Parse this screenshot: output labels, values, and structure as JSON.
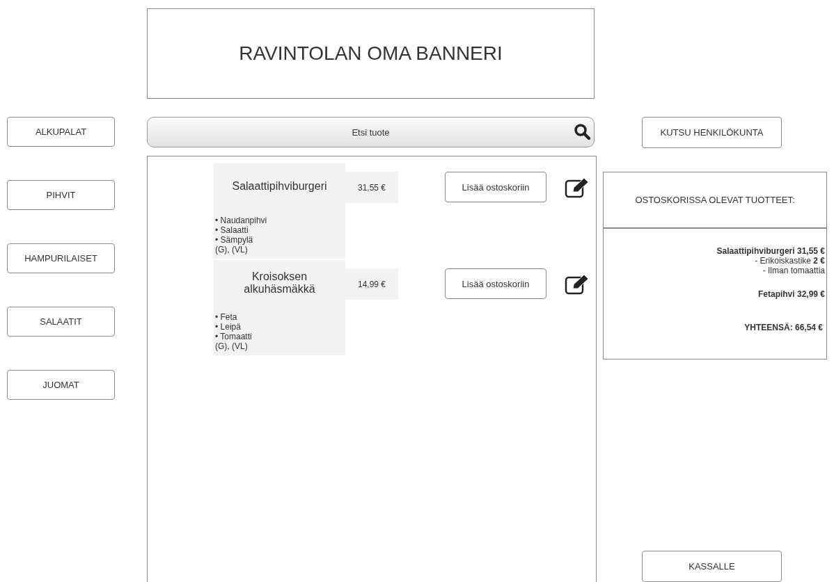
{
  "banner": {
    "text": "RAVINTOLAN OMA BANNERI"
  },
  "categories": [
    {
      "label": "ALKUPALAT"
    },
    {
      "label": "PIHVIT"
    },
    {
      "label": "HAMPURILAISET"
    },
    {
      "label": "SALAATIT"
    },
    {
      "label": "JUOMAT"
    }
  ],
  "search": {
    "placeholder": "Etsi tuote"
  },
  "products": [
    {
      "name": "Salaattipihviburgeri",
      "price": "31,55 €",
      "ingredients": [
        "• Naudanpihvi",
        "• Salaatti",
        "• Sämpylä"
      ],
      "diet": "(G), (VL)",
      "button": "Lisää ostoskoriin"
    },
    {
      "name": "Kroisoksen alkuhäsmäkkä",
      "price": "14,99 €",
      "ingredients": [
        "• Feta",
        "• Leipä",
        "• Tomaatti"
      ],
      "diet": "(G), (VL)",
      "button": "Lisää ostoskoriin"
    }
  ],
  "staff_button": "KUTSU HENKILÖKUNTA",
  "cart": {
    "title": "OSTOSKORISSA OLEVAT TUOTTEET:",
    "lines": [
      {
        "kind": "item",
        "text": "Salaattipihviburgeri 31,55 €"
      },
      {
        "kind": "option",
        "text": "- Erikoiskastike **2 €**"
      },
      {
        "kind": "option",
        "text": "- Ilman tomaattia"
      },
      {
        "kind": "item",
        "text": "Fetapihvi 32,99 €"
      },
      {
        "kind": "total",
        "text": "YHTEENSÄ: 66,54 €"
      }
    ]
  },
  "checkout_button": "KASSALLE"
}
